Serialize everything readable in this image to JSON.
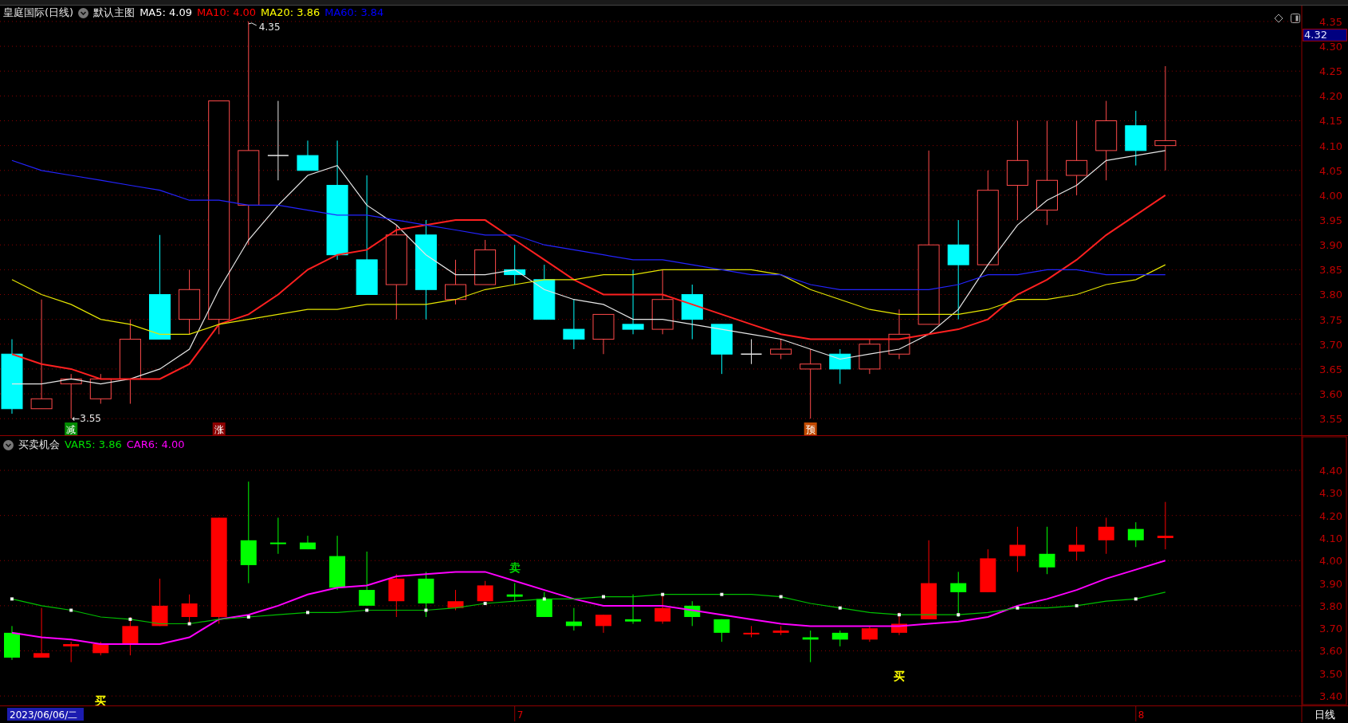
{
  "main": {
    "header": {
      "title": "皇庭国际(日线)",
      "template": "默认主图",
      "legend": [
        {
          "text": "MA5: 4.09",
          "color": "#ffffff"
        },
        {
          "text": "MA10: 4.00",
          "color": "#ff0000"
        },
        {
          "text": "MA20: 3.86",
          "color": "#ffff00"
        },
        {
          "text": "MA60: 3.84",
          "color": "#0000ff"
        }
      ]
    },
    "price_tag": "4.32",
    "axis_labels": [
      "4.35",
      "4.30",
      "4.25",
      "4.20",
      "4.15",
      "4.10",
      "4.05",
      "4.00",
      "3.95",
      "3.90",
      "3.85",
      "3.80",
      "3.75",
      "3.70",
      "3.65",
      "3.60",
      "3.55"
    ],
    "high_label": "4.35",
    "low_label": "←3.55",
    "signals": [
      {
        "text": "减",
        "color": "#008a00"
      },
      {
        "text": "涨",
        "color": "#8b0000"
      },
      {
        "text": "预",
        "color": "#c04a00"
      }
    ]
  },
  "lower": {
    "header": {
      "title": "买卖机会",
      "legend": [
        {
          "text": "VAR5: 3.86",
          "color": "#00e000"
        },
        {
          "text": "CAR6: 4.00",
          "color": "#ff00ff"
        }
      ]
    },
    "axis_labels": [
      "4.40",
      "4.30",
      "4.20",
      "4.10",
      "4.00",
      "3.90",
      "3.80",
      "3.70",
      "3.60",
      "3.50",
      "3.40"
    ],
    "signals": [
      {
        "text": "卖",
        "color": "#00d000"
      },
      {
        "text": "买",
        "color": "#ffff00"
      },
      {
        "text": "买",
        "color": "#ffff00"
      }
    ]
  },
  "bottom_bar": {
    "cursor_date": "2023/06/06/二",
    "date_labels": [
      "7",
      "8"
    ],
    "period": "日线"
  }
}
